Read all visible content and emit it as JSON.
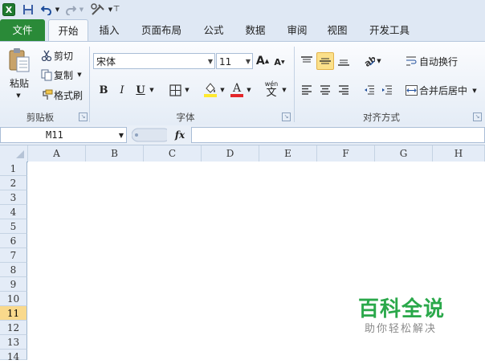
{
  "quick_access": {
    "items": [
      "excel-logo-icon",
      "save-icon",
      "undo-icon",
      "redo-icon",
      "customize-icon",
      "more-icon"
    ]
  },
  "tabs": [
    {
      "label": "文件",
      "id": "file"
    },
    {
      "label": "开始",
      "id": "home",
      "active": true
    },
    {
      "label": "插入",
      "id": "insert"
    },
    {
      "label": "页面布局",
      "id": "page-layout"
    },
    {
      "label": "公式",
      "id": "formulas"
    },
    {
      "label": "数据",
      "id": "data"
    },
    {
      "label": "审阅",
      "id": "review"
    },
    {
      "label": "视图",
      "id": "view"
    },
    {
      "label": "开发工具",
      "id": "developer"
    }
  ],
  "clipboard": {
    "paste_label": "粘贴",
    "cut_label": "剪切",
    "copy_label": "复制",
    "format_painter_label": "格式刷",
    "group_label": "剪贴板"
  },
  "font": {
    "font_name": "宋体",
    "font_size": "11",
    "bold": "B",
    "italic": "I",
    "underline": "U",
    "phonetic": "wén",
    "group_label": "字体"
  },
  "alignment": {
    "wrap_text_label": "自动换行",
    "merge_center_label": "合并后居中",
    "group_label": "对齐方式"
  },
  "formula_bar": {
    "name_box": "M11",
    "fx": "fx",
    "formula": ""
  },
  "grid": {
    "columns": [
      "A",
      "B",
      "C",
      "D",
      "E",
      "F",
      "G",
      "H"
    ],
    "rows": [
      "1",
      "2",
      "3",
      "4",
      "5",
      "6",
      "7",
      "8",
      "9",
      "10",
      "11",
      "12",
      "13",
      "14"
    ],
    "selected_row": "11"
  },
  "watermark": {
    "title": "百科全说",
    "subtitle": "助你轻松解决"
  },
  "colors": {
    "file_tab": "#2a8a38",
    "highlight": "#fbe08a",
    "row_selected": "#f9d98c",
    "watermark": "#2aa84a"
  }
}
